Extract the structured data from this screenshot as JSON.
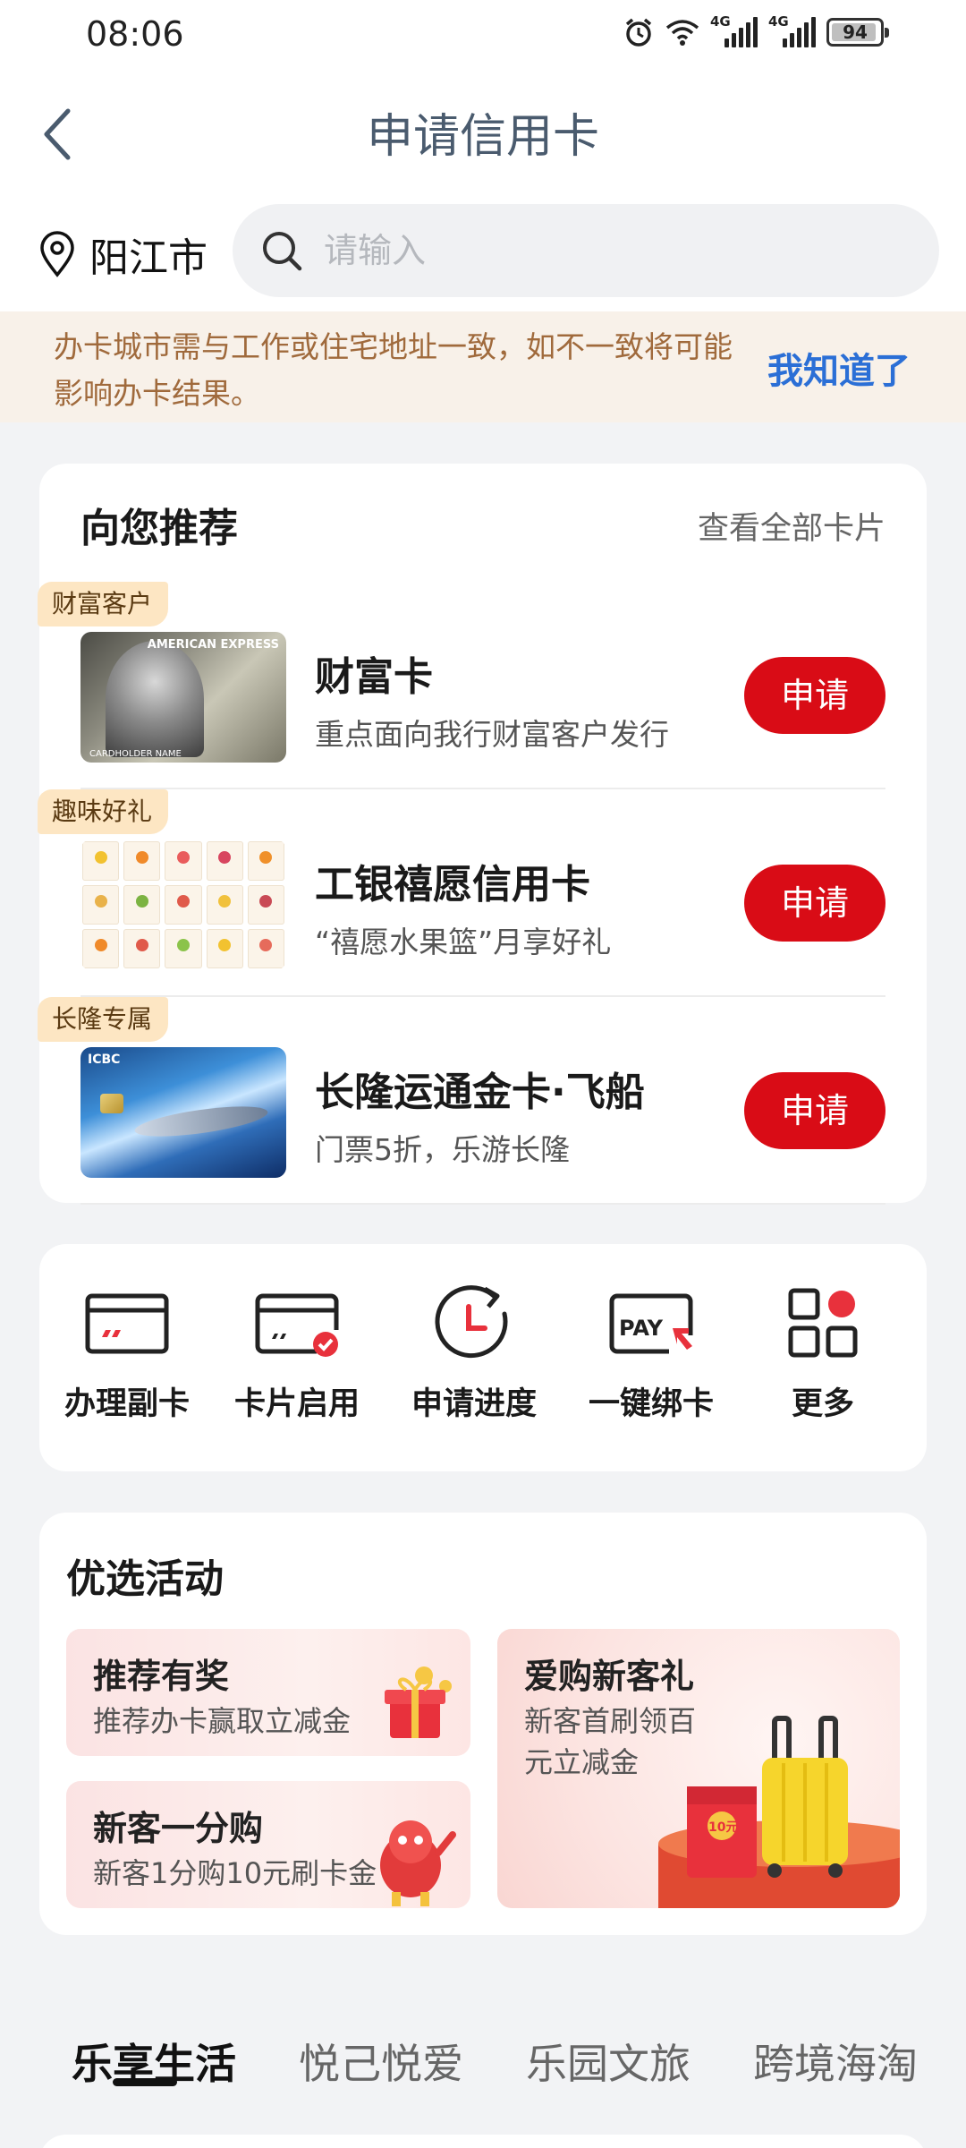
{
  "status_bar": {
    "time": "08:06",
    "net1": "4G",
    "net2": "4G",
    "battery": "94",
    "battery_pct": 0.94
  },
  "header": {
    "title": "申请信用卡"
  },
  "location": {
    "city": "阳江市"
  },
  "search": {
    "placeholder": "请输入"
  },
  "notice": {
    "text": "办卡城市需与工作或住宅地址一致，如不一致将可能影响办卡结果。",
    "dismiss": "我知道了"
  },
  "recommend": {
    "title": "向您推荐",
    "view_all": "查看全部卡片",
    "items": [
      {
        "tag": "财富客户",
        "name": "财富卡",
        "desc": "重点面向我行财富客户发行",
        "apply": "申请"
      },
      {
        "tag": "趣味好礼",
        "name": "工银禧愿信用卡",
        "desc": "“禧愿水果篮”月享好礼",
        "apply": "申请"
      },
      {
        "tag": "长隆专属",
        "name": "长隆运通金卡·飞船",
        "desc": "门票5折，乐游长隆",
        "apply": "申请"
      }
    ],
    "card_art": {
      "amex": "AMERICAN EXPRESS",
      "cardholder": "CARDHOLDER NAME",
      "icbc": "ICBC"
    }
  },
  "quick_actions": [
    {
      "label": "办理副卡",
      "icon": "card-icon"
    },
    {
      "label": "卡片启用",
      "icon": "card-activate-icon"
    },
    {
      "label": "申请进度",
      "icon": "progress-icon"
    },
    {
      "label": "一键绑卡",
      "icon": "pay-bind-icon"
    },
    {
      "label": "更多",
      "icon": "more-grid-icon"
    }
  ],
  "activities": {
    "title": "优选活动",
    "tiles": [
      {
        "title": "推荐有奖",
        "desc": "推荐办卡赢取立减金"
      },
      {
        "title": "新客一分购",
        "desc": "新客1分购10元刷卡金"
      },
      {
        "title": "爱购新客礼",
        "desc": "新客首刷领百元立减金"
      }
    ],
    "envelope_text": "10元"
  },
  "tabs": [
    "乐享生活",
    "悦己悦爱",
    "乐园文旅",
    "跨境海淘"
  ],
  "colors": {
    "accent_red": "#d90c16",
    "link_blue": "#2b6fd6",
    "notice_text": "#a06a3c",
    "notice_bg": "#f8f1e9"
  }
}
